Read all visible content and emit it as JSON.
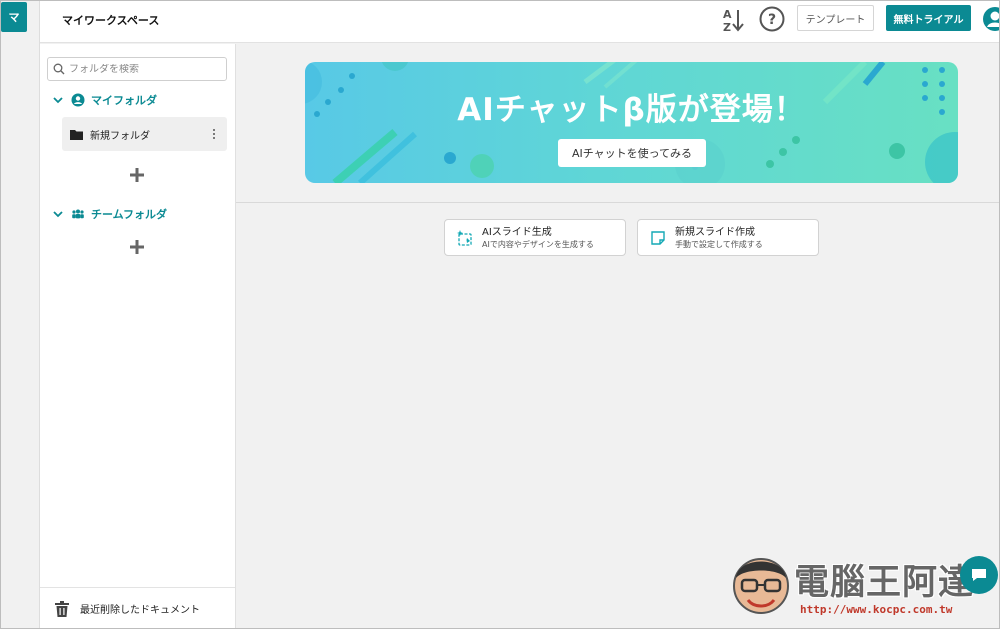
{
  "rail": {
    "badge": "マ"
  },
  "header": {
    "workspace_title": "マイワークスペース",
    "template_label": "テンプレート",
    "trial_label": "無料トライアル"
  },
  "sidebar": {
    "search_placeholder": "フォルダを検索",
    "my_folders_label": "マイフォルダ",
    "folders": [
      {
        "label": "新規フォルダ"
      }
    ],
    "team_folders_label": "チームフォルダ",
    "trash_label": "最近削除したドキュメント"
  },
  "banner": {
    "title": "AIチャットβ版が登場！",
    "button_label": "AIチャットを使ってみる"
  },
  "actions": [
    {
      "title": "AIスライド生成",
      "subtitle": "AIで内容やデザインを生成する"
    },
    {
      "title": "新規スライド作成",
      "subtitle": "手動で設定して作成する"
    }
  ],
  "watermark": {
    "title": "電腦王阿達",
    "url": "http://www.kocpc.com.tw"
  },
  "colors": {
    "accent": "#0b8a93",
    "banner_start": "#58c9e6",
    "banner_end": "#68e0c3"
  }
}
